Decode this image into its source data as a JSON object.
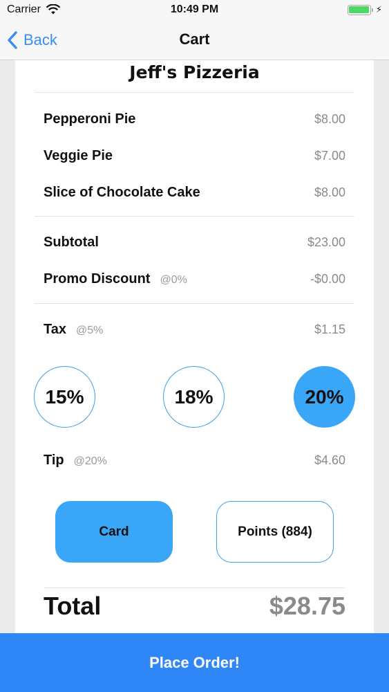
{
  "status_bar": {
    "carrier": "Carrier",
    "time": "10:49 PM"
  },
  "nav": {
    "back_label": "Back",
    "title": "Cart"
  },
  "receipt": {
    "restaurant": "Jeff's Pizzeria",
    "items": [
      {
        "name": "Pepperoni Pie",
        "price": "$8.00"
      },
      {
        "name": "Veggie Pie",
        "price": "$7.00"
      },
      {
        "name": "Slice of Chocolate Cake",
        "price": "$8.00"
      }
    ],
    "subtotal": {
      "label": "Subtotal",
      "value": "$23.00"
    },
    "promo": {
      "label": "Promo Discount",
      "rate": "@0%",
      "value": "-$0.00"
    },
    "tax": {
      "label": "Tax",
      "rate": "@5%",
      "value": "$1.15"
    },
    "tip_options": [
      {
        "label": "15%",
        "selected": false
      },
      {
        "label": "18%",
        "selected": false
      },
      {
        "label": "20%",
        "selected": true
      }
    ],
    "tip": {
      "label": "Tip",
      "rate": "@20%",
      "value": "$4.60"
    },
    "payment": {
      "card_label": "Card",
      "points_label": "Points (884)",
      "selected": "Card"
    },
    "total": {
      "label": "Total",
      "value": "$28.75"
    }
  },
  "place_order_label": "Place Order!",
  "colors": {
    "accent": "#3aa6f7",
    "primary_button": "#2f86f6",
    "battery": "#4cd964",
    "link": "#3b8ef0"
  }
}
